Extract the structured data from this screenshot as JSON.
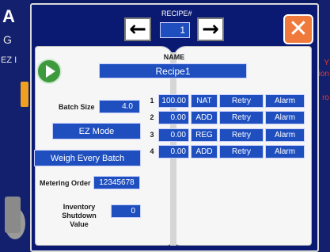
{
  "background": {
    "app_title": "A",
    "sub_label": "G",
    "ez_label": "EZ I",
    "right_texts": [
      "Y",
      "ition",
      "ro"
    ]
  },
  "header": {
    "recipe_label": "RECIPE#",
    "recipe_number": "1",
    "prev_icon": "arrow-left-icon",
    "next_icon": "arrow-right-icon",
    "close_icon": "close-icon"
  },
  "form": {
    "name_label": "NAME",
    "name_value": "Recipe1",
    "batch_size_label": "Batch Size",
    "batch_size_value": "4.0",
    "mode_button": "EZ Mode",
    "weigh_button": "Weigh Every Batch",
    "metering_order_label": "Metering Order",
    "metering_order_value": "12345678",
    "inventory_label_line1": "Inventory",
    "inventory_label_line2": "Shutdown Value",
    "inventory_value": "0"
  },
  "ingredients": [
    {
      "num": "1",
      "amount": "100.00",
      "mode": "NAT",
      "retry": "Retry",
      "alarm": "Alarm"
    },
    {
      "num": "2",
      "amount": "0.00",
      "mode": "ADD",
      "retry": "Retry",
      "alarm": "Alarm"
    },
    {
      "num": "3",
      "amount": "0.00",
      "mode": "REG",
      "retry": "Retry",
      "alarm": "Alarm"
    },
    {
      "num": "4",
      "amount": "0.00",
      "mode": "ADD",
      "retry": "Retry",
      "alarm": "Alarm"
    }
  ],
  "colors": {
    "field_blue": "#1f4fbf",
    "frame_navy": "#0a1a72",
    "close_orange": "#f07a3c",
    "play_green": "#3d9a3d"
  }
}
